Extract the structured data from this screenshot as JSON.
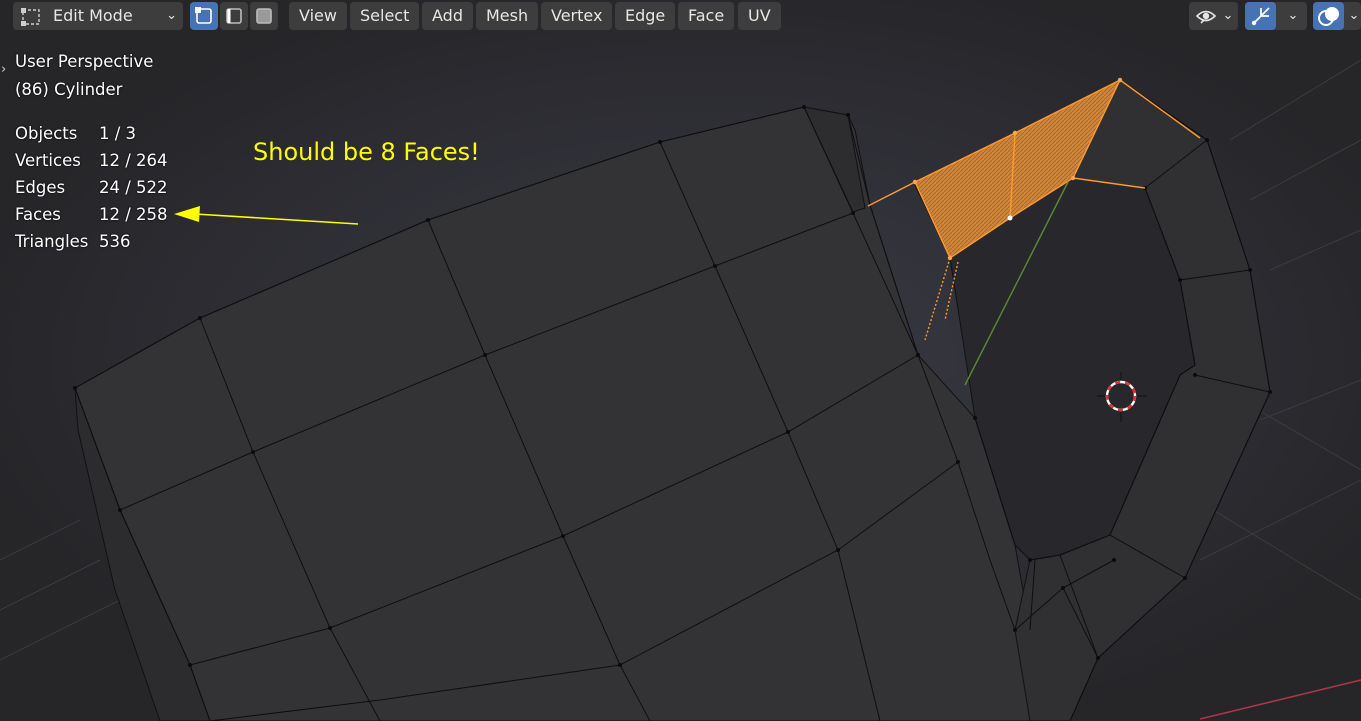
{
  "header": {
    "mode_label": "Edit Mode",
    "select_modes": [
      "vertex-select",
      "edge-select",
      "face-select"
    ],
    "active_select_mode": "vertex-select",
    "menu": {
      "view": "View",
      "select": "Select",
      "add": "Add",
      "mesh": "Mesh",
      "vertex": "Vertex",
      "edge": "Edge",
      "face": "Face",
      "uv": "UV"
    },
    "right_icons": [
      "visibility-eye-icon",
      "gizmo-icon",
      "overlay-icon"
    ]
  },
  "viewport_info": {
    "perspective": "User Perspective",
    "object": "(86) Cylinder"
  },
  "stats": {
    "objects_label": "Objects",
    "objects_value": "1 / 3",
    "vertices_label": "Vertices",
    "vertices_value": "12 / 264",
    "edges_label": "Edges",
    "edges_value": "24 / 522",
    "faces_label": "Faces",
    "faces_value": "12 / 258",
    "triangles_label": "Triangles",
    "triangles_value": "536"
  },
  "annotation": {
    "text": "Should be 8 Faces!",
    "color": "#ffff00"
  },
  "colors": {
    "background": "#262629",
    "mesh_face": "#333336",
    "selection": "#ff8c00",
    "accent_active": "#4772b3"
  }
}
